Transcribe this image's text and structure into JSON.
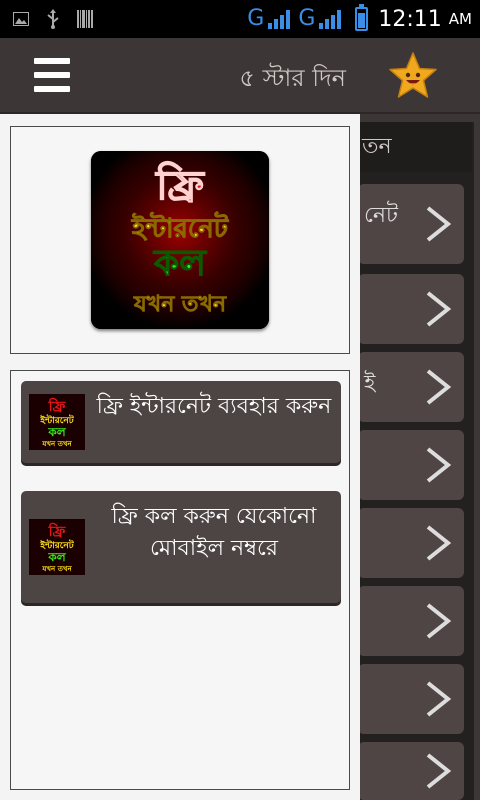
{
  "status_bar": {
    "network_1": "G",
    "network_2": "G",
    "time": "12:11",
    "ampm": "AM",
    "icons": [
      "image-icon",
      "usb-icon",
      "barcode-icon",
      "signal-icon",
      "battery-icon"
    ]
  },
  "app_bar": {
    "menu_icon": "hamburger-menu-icon",
    "rate_label": "৫ স্টার দিন",
    "star_icon": "star-smile-icon"
  },
  "logo": {
    "line1": "ফ্রি",
    "line2": "ইন্টারনেট",
    "line3": "কল",
    "line4": "যখন তখন"
  },
  "drawer_menu": {
    "items": [
      {
        "label": "ফ্রি ইন্টারনেট ব্যবহার করুন"
      },
      {
        "label": "ফ্রি কল করুন যেকোনো মোবাইল নম্বরে"
      }
    ]
  },
  "background_page": {
    "header_snippet": "তন",
    "card_snippets": [
      "নেট",
      "",
      "ই",
      "",
      "",
      "",
      "",
      ""
    ]
  },
  "colors": {
    "appbar_bg": "#3d3636",
    "drawer_bg": "#f4f4f4",
    "menu_item_bg": "#4d4444",
    "status_accent": "#3a8ee6",
    "logo_red": "#e8141a",
    "logo_yellow": "#ffe21a",
    "logo_green": "#37e81a"
  }
}
